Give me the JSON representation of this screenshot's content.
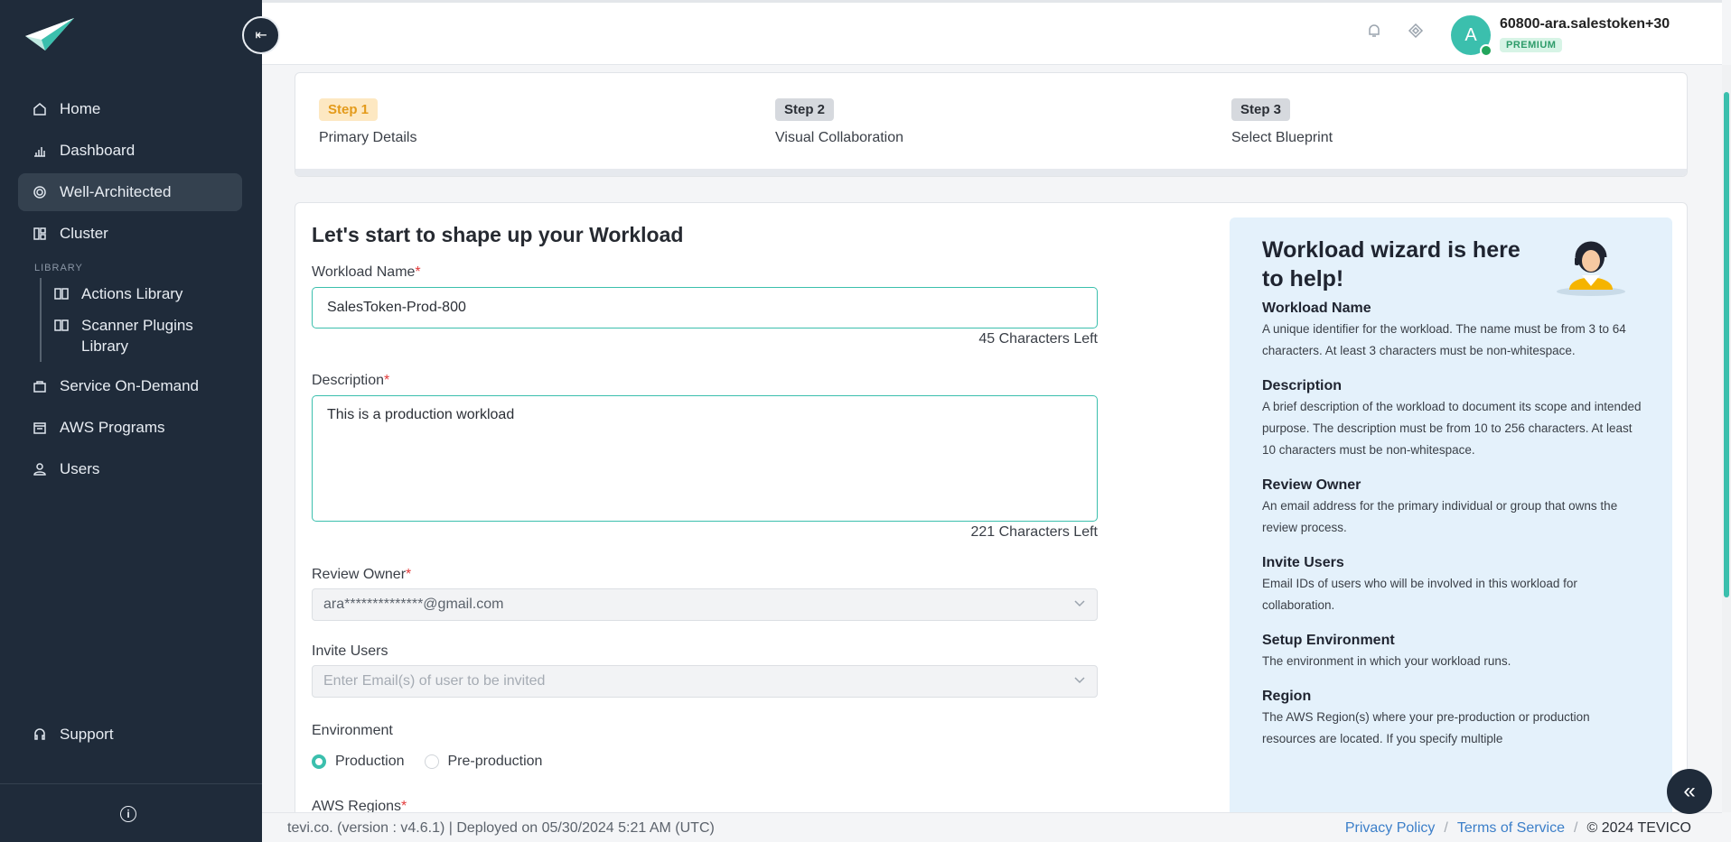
{
  "sidebar": {
    "items": [
      {
        "label": "Home",
        "icon": "home-icon"
      },
      {
        "label": "Dashboard",
        "icon": "chart-icon"
      },
      {
        "label": "Well-Architected",
        "icon": "target-icon"
      },
      {
        "label": "Cluster",
        "icon": "cluster-icon"
      }
    ],
    "library_title": "LIBRARY",
    "library_items": [
      {
        "label": "Actions Library",
        "icon": "book-icon"
      },
      {
        "label": "Scanner Plugins Library",
        "icon": "book-icon"
      }
    ],
    "items_after": [
      {
        "label": "Service On-Demand",
        "icon": "bag-icon"
      },
      {
        "label": "AWS Programs",
        "icon": "programs-icon"
      },
      {
        "label": "Users",
        "icon": "user-icon"
      }
    ],
    "support_label": "Support",
    "collapse_glyph": "⇤",
    "info_glyph": "i"
  },
  "header": {
    "user_name": "60800-ara.salestoken+30",
    "badge": "PREMIUM",
    "avatar_initial": "A"
  },
  "steps": [
    {
      "badge": "Step 1",
      "label": "Primary Details"
    },
    {
      "badge": "Step 2",
      "label": "Visual Collaboration"
    },
    {
      "badge": "Step 3",
      "label": "Select Blueprint"
    }
  ],
  "form": {
    "title": "Let's start to shape up your Workload",
    "workload_name_label": "Workload Name",
    "workload_name_value": "SalesToken-Prod-800",
    "workload_name_counter": "45 Characters Left",
    "description_label": "Description",
    "description_value": "This is a production workload",
    "description_counter": "221 Characters Left",
    "review_owner_label": "Review Owner",
    "review_owner_value": "ara**************@gmail.com",
    "invite_users_label": "Invite Users",
    "invite_users_placeholder": "Enter Email(s) of user to be invited",
    "environment_label": "Environment",
    "env_production": "Production",
    "env_preproduction": "Pre-production",
    "aws_regions_label": "AWS Regions",
    "required_mark": "*"
  },
  "help": {
    "title": "Workload wizard is here to help!",
    "sections": [
      {
        "heading": "Workload Name",
        "text": "A unique identifier for the workload. The name must be from 3 to 64 characters. At least 3 characters must be non-whitespace."
      },
      {
        "heading": "Description",
        "text": "A brief description of the workload to document its scope and intended purpose. The description must be from 10 to 256 characters. At least 10 characters must be non-whitespace."
      },
      {
        "heading": "Review Owner",
        "text": "An email address for the primary individual or group that owns the review process."
      },
      {
        "heading": "Invite Users",
        "text": "Email IDs of users who will be involved in this workload for collaboration."
      },
      {
        "heading": "Setup Environment",
        "text": "The environment in which your workload runs."
      },
      {
        "heading": "Region",
        "text": "The AWS Region(s) where your pre-production or production resources are located. If you specify multiple"
      }
    ]
  },
  "footer": {
    "version_text": "tevi.co. (version : v4.6.1) | Deployed on 05/30/2024 5:21 AM (UTC)",
    "privacy": "Privacy Policy",
    "terms": "Terms of Service",
    "sep": "/",
    "copyright": "© 2024 TEVICO"
  },
  "float_button_glyph": "«",
  "colors": {
    "accent": "#3bbfad",
    "sidebar_bg": "#1f2b3a",
    "step_active_bg": "#fde8c2",
    "help_bg": "#e4f1fb"
  }
}
